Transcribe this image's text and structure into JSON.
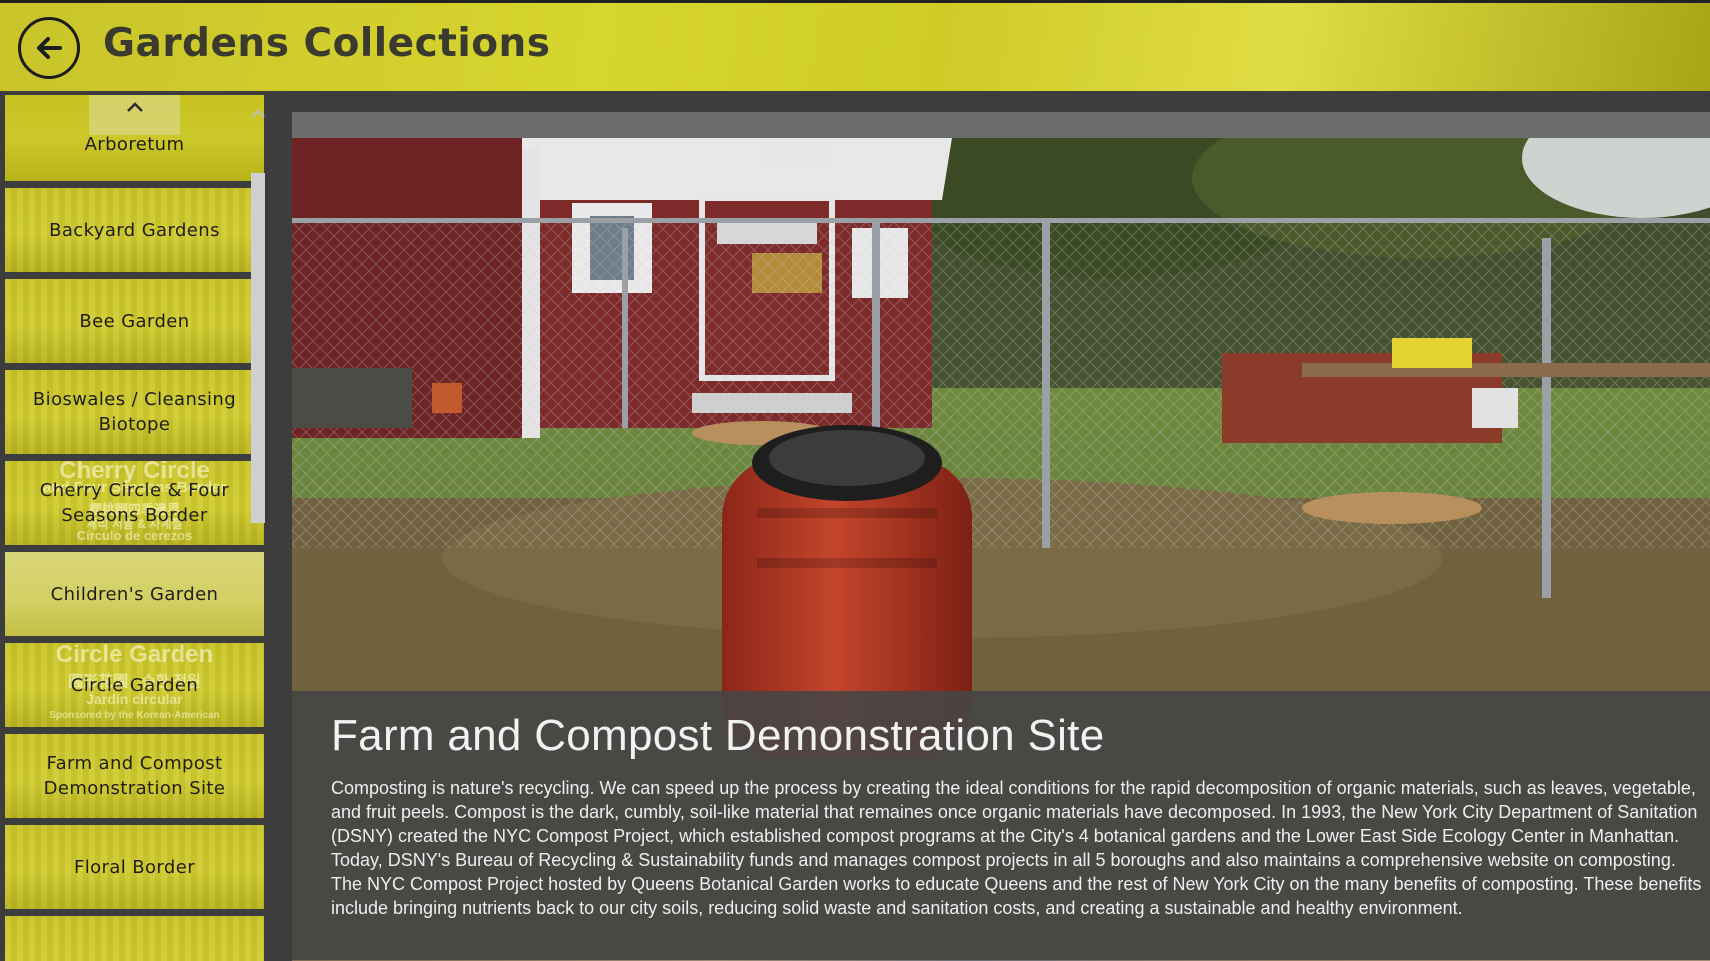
{
  "header": {
    "title": "Gardens Collections",
    "back_icon": "back-arrow-icon"
  },
  "sidebar": {
    "items": [
      {
        "label": "Arboretum"
      },
      {
        "label": "Backyard Gardens"
      },
      {
        "label": "Bee Garden"
      },
      {
        "label": "Bioswales / Cleansing Biotope"
      },
      {
        "label": "Cherry Circle & Four Seasons Border",
        "overlay": [
          "Cherry Circle",
          "and Four Seasons Border",
          "櫻桃圈四季邊界",
          "체리 서클 & 사계절",
          "Círculo de cerezos"
        ]
      },
      {
        "label": "Children's Garden"
      },
      {
        "label": "Circle Garden",
        "overlay": [
          "Circle Garden",
          "圓形花園 · 순환 정원",
          "Jardín circular",
          "Sponsored by the Korean-American"
        ]
      },
      {
        "label": "Farm and Compost Demonstration Site"
      },
      {
        "label": "Floral Border"
      }
    ]
  },
  "detail": {
    "title": "Farm and Compost Demonstration Site",
    "description": "Composting is nature's recycling. We can speed up the process by creating the ideal conditions for the rapid decomposition of organic materials, such as leaves, vegetable, and fruit peels. Compost is the dark, cumbly, soil-like material that remaines once organic materials have decomposed. In 1993, the New York City Department of Sanitation (DSNY) created the NYC Compost Project, which established compost programs at the City's 4 botanical gardens and the Lower East Side Ecology Center in Manhattan. Today, DSNY's Bureau of Recycling & Sustainability funds and manages compost projects in all 5 boroughs and also maintains a comprehensive website on composting. The NYC Compost Project hosted by Queens Botanical Garden works to educate Queens and the rest of New York City on the many benefits of composting. These benefits include bringing nutrients back to our city soils, reducing solid waste and sanitation costs, and creating a sustainable and healthy environment."
  },
  "colors": {
    "header_accent": "#cfcc28",
    "tile_yellow": "#c9c424",
    "panel_bg": "#3d3d3d",
    "caption_bg": "#464646"
  }
}
